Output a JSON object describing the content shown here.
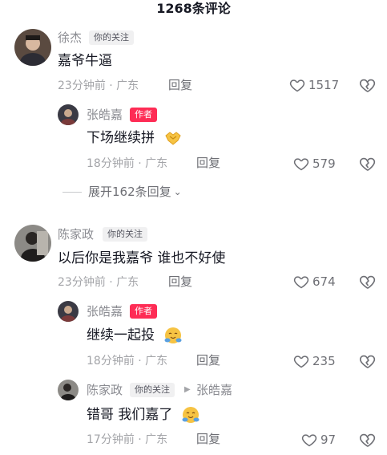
{
  "header": {
    "title": "1268条评论"
  },
  "comments": [
    {
      "user": "徐杰",
      "badge": "你的关注",
      "text": "嘉爷牛逼",
      "time": "23分钟前 · 广东",
      "reply_label": "回复",
      "likes": "1517"
    },
    {
      "user": "张皓嘉",
      "badge": "作者",
      "text": "下场继续拼",
      "emoji": "handshake-emoji",
      "time": "18分钟前 · 广东",
      "reply_label": "回复",
      "likes": "579"
    },
    {
      "user": "陈家政",
      "badge": "你的关注",
      "text": "以后你是我嘉爷 谁也不好使",
      "time": "23分钟前 · 广东",
      "reply_label": "回复",
      "likes": "674"
    },
    {
      "user": "张皓嘉",
      "badge": "作者",
      "text": "继续一起投",
      "emoji": "hug-emoji",
      "time": "18分钟前 · 广东",
      "reply_label": "回复",
      "likes": "235"
    },
    {
      "user": "陈家政",
      "badge": "你的关注",
      "reply_to": "张皓嘉",
      "text": "错哥 我们嘉了",
      "emoji": "hug-emoji",
      "time": "17分钟前 · 广东",
      "reply_label": "回复",
      "likes": "97"
    }
  ],
  "expand": {
    "label": "展开162条回复"
  },
  "icons": {
    "like": "heart-outline-icon",
    "dislike": "broken-heart-icon",
    "expand": "chevron-down-icon"
  },
  "colors": {
    "author_badge": "#fe2c55",
    "muted_text": "#a3a4a8"
  }
}
